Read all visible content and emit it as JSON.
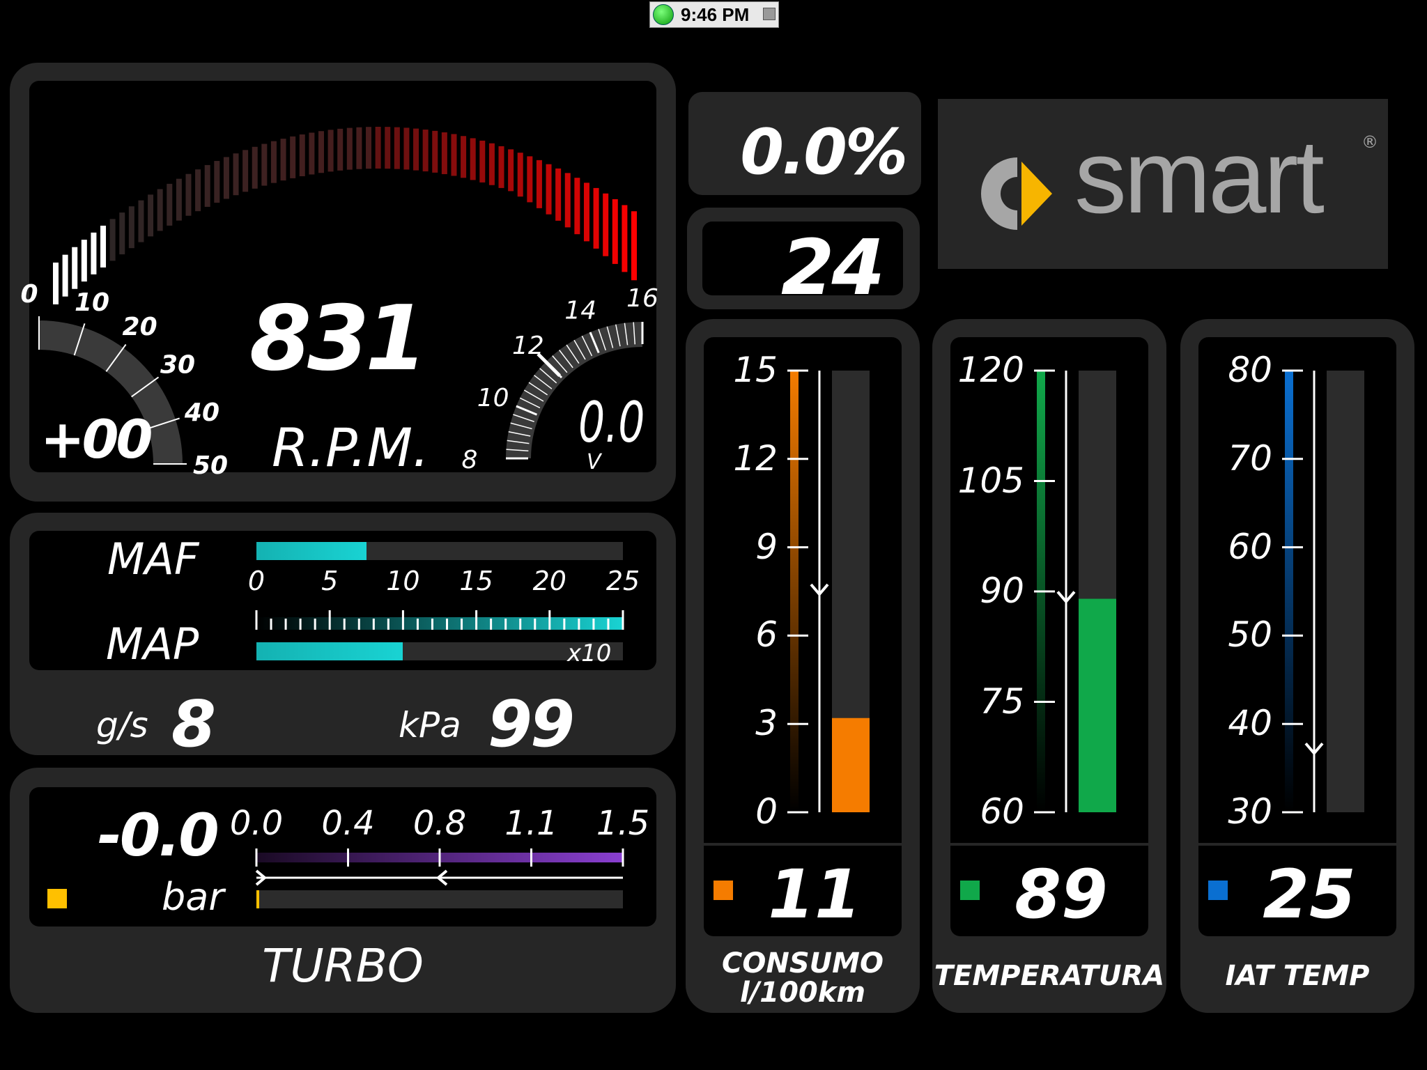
{
  "status_bar": {
    "time": "9:46 PM"
  },
  "tachometer": {
    "rpm_value": "831",
    "rpm_label": "R.P.M.",
    "rpm_fraction": 0.1,
    "offset_value": "+00",
    "left_scale_labels": [
      "0",
      "10",
      "20",
      "30",
      "40",
      "50"
    ],
    "voltage_scale_labels": [
      "8",
      "10",
      "12",
      "14",
      "16"
    ],
    "voltage_value": "0.0",
    "voltage_unit": "V",
    "colors": {
      "lit": "#ffffff",
      "red": "#ff1a1a"
    }
  },
  "throttle": {
    "value": "0.0%"
  },
  "speed": {
    "value": "24"
  },
  "brand": {
    "logo_text": "smart",
    "registered": "®",
    "colors": {
      "grey": "#a6a6a6",
      "yellow": "#f7b500"
    }
  },
  "airflow": {
    "maf_label": "MAF",
    "map_label": "MAP",
    "maf_fraction": 0.3,
    "map_fraction": 0.4,
    "scale_labels": [
      "0",
      "5",
      "10",
      "15",
      "20",
      "25"
    ],
    "multiplier": "x10",
    "maf_unit": "g/s",
    "maf_value": "8",
    "map_unit": "kPa",
    "map_value": "99",
    "color": "#19d3d3"
  },
  "turbo": {
    "value": "-0.0",
    "unit": "bar",
    "title": "TURBO",
    "scale_labels": [
      "0.0",
      "0.4",
      "0.8",
      "1.1",
      "1.5"
    ],
    "fill_fraction": 0.0,
    "color": "#8a3fd1",
    "indicator_color": "#ffc000"
  },
  "gauges": [
    {
      "id": "consumo",
      "title_line1": "CONSUMO",
      "title_line2": "l/100km",
      "scale": [
        "15",
        "12",
        "9",
        "6",
        "3",
        "0"
      ],
      "min": 0,
      "max": 15,
      "value": "11",
      "bar_value": 3.2,
      "marker_value": 7.5,
      "color": "#f57c00"
    },
    {
      "id": "temperatura",
      "title_line1": "TEMPERATURA",
      "title_line2": "",
      "scale": [
        "120",
        "105",
        "90",
        "75",
        "60"
      ],
      "min": 60,
      "max": 120,
      "value": "89",
      "bar_value": 89,
      "marker_value": 89,
      "color": "#10a84a"
    },
    {
      "id": "iat",
      "title_line1": "IAT TEMP",
      "title_line2": "",
      "scale": [
        "80",
        "70",
        "60",
        "50",
        "40",
        "30"
      ],
      "min": 30,
      "max": 80,
      "value": "25",
      "bar_value": 25,
      "marker_value": 37,
      "color": "#0a6fd1"
    }
  ]
}
